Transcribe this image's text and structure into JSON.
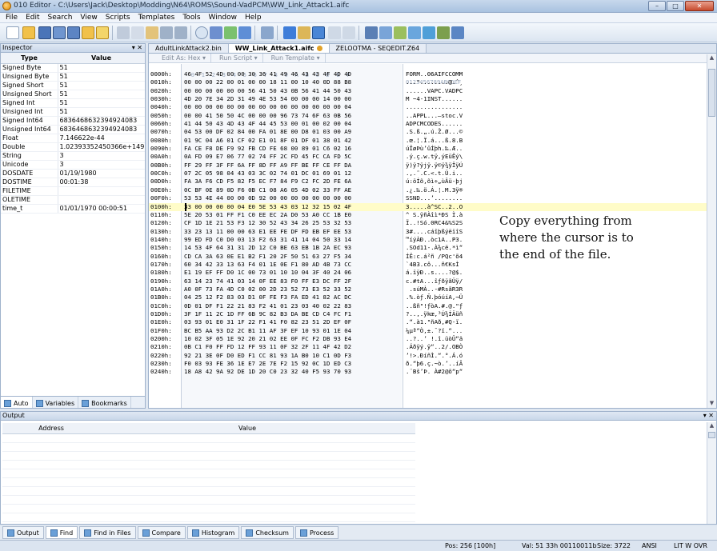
{
  "window": {
    "title": "010 Editor - C:\\Users\\Jack\\Desktop\\Modding\\N64\\ROMS\\Sound-VadPCM\\WW_Link_Attack1.aifc",
    "minimize": "–",
    "maximize": "□",
    "close": "✕"
  },
  "menu": [
    "File",
    "Edit",
    "Search",
    "View",
    "Scripts",
    "Templates",
    "Tools",
    "Window",
    "Help"
  ],
  "inspector": {
    "title": "Inspector",
    "controls": "▾ ✕",
    "col_type": "Type",
    "col_value": "Value",
    "rows": [
      {
        "type": "Signed Byte",
        "value": "51"
      },
      {
        "type": "Unsigned Byte",
        "value": "51"
      },
      {
        "type": "Signed Short",
        "value": "51"
      },
      {
        "type": "Unsigned Short",
        "value": "51"
      },
      {
        "type": "Signed Int",
        "value": "51"
      },
      {
        "type": "Unsigned Int",
        "value": "51"
      },
      {
        "type": "Signed Int64",
        "value": "6836468632394924083"
      },
      {
        "type": "Unsigned Int64",
        "value": "6836468632394924083"
      },
      {
        "type": "Float",
        "value": "7.146622e-44"
      },
      {
        "type": "Double",
        "value": "1.02393352450366e+149"
      },
      {
        "type": "String",
        "value": "3"
      },
      {
        "type": "Unicode",
        "value": "3"
      },
      {
        "type": "DOSDATE",
        "value": "01/19/1980"
      },
      {
        "type": "DOSTIME",
        "value": "00:01:38"
      },
      {
        "type": "FILETIME",
        "value": ""
      },
      {
        "type": "OLETIME",
        "value": ""
      },
      {
        "type": "time_t",
        "value": "01/01/1970 00:00:51"
      }
    ],
    "tabs": [
      "Auto",
      "Variables",
      "Bookmarks"
    ]
  },
  "editor": {
    "tabs": [
      {
        "label": "AdultLinkAttack2.bin",
        "active": false
      },
      {
        "label": "WW_Link_Attack1.aifc",
        "active": true
      },
      {
        "label": "ZELOOTMA - SEQEDIT.Z64",
        "active": false
      }
    ],
    "subbar": [
      "Edit As: Hex ▾",
      "Run Script ▾",
      "Run Template ▾"
    ],
    "header_hex": "  0  1  2  3  4  5  6  7  8  9  A  B  C  D  E  F",
    "header_ascii": "0123456789ABCDEF",
    "rows": [
      {
        "addr": "0000h:",
        "hex": "46 4F 52 4D 00 00 30 36 41 49 46 43 43 4F 4D 4D",
        "ascii": "FORM..06AIFCCOMM"
      },
      {
        "addr": "0010h:",
        "hex": "00 00 00 22 00 01 00 00 18 11 00 10 40 0D 88 B8",
        "ascii": "...\"........@.ˆ¸"
      },
      {
        "addr": "0020h:",
        "hex": "00 00 00 00 00 00 56 41 50 43 0B 56 41 44 50 43",
        "ascii": "......VAPC.VADPC"
      },
      {
        "addr": "0030h:",
        "hex": "4D 20 7E 34 2D 31 49 4E 53 54 00 00 00 14 00 00",
        "ascii": "M ~4-1INST......"
      },
      {
        "addr": "0040h:",
        "hex": "00 00 00 00 00 00 00 00 00 00 00 00 00 00 00 04",
        "ascii": "................"
      },
      {
        "addr": "0050h:",
        "hex": "00 00 41 50 50 4C 00 00 00 96 73 74 6F 63 0B 56",
        "ascii": "..APPL...–stoc.V"
      },
      {
        "addr": "0060h:",
        "hex": "41 44 50 43 4D 43 4F 44 45 53 00 01 00 02 00 04",
        "ascii": "ADPCMCODES......"
      },
      {
        "addr": "0070h:",
        "hex": "04 53 00 DF 02 84 00 FA 01 8E 00 D8 01 03 00 A9",
        "ascii": ".S.ß.„.ú.Ž.Ø...©"
      },
      {
        "addr": "0080h:",
        "hex": "01 9C 04 A6 01 CF 02 E1 01 8F 01 DF 01 38 01 42",
        "ascii": ".œ.¦.Ï.á...ß.8.B"
      },
      {
        "addr": "0090h:",
        "hex": "FA CE F8 DE F9 92 FB CD FE 68 00 89 01 C6 02 16",
        "ascii": "úÎøÞù’ûÍþh.‰.Æ.."
      },
      {
        "addr": "00A0h:",
        "hex": "0A FD 09 E7 06 77 02 74 FF 2C FD 45 FC CA FD 5C",
        "ascii": ".ý.ç.w.tÿ,ýEüÊý\\"
      },
      {
        "addr": "00B0h:",
        "hex": "FF 29 FF 3F FF 6A FF 8D FF A9 FF BE FF CE FF DA",
        "ascii": "ÿ)ÿ?ÿjÿ.ÿ©ÿ¾ÿÎÿÚ"
      },
      {
        "addr": "00C0h:",
        "hex": "07 2C 05 98 04 43 03 3C 02 74 01 DC 01 69 01 12",
        "ascii": ".,.˜.C.<.t.Ü.i.."
      },
      {
        "addr": "00D0h:",
        "hex": "FA 3A F6 CD F5 82 F5 EC F7 84 F9 C2 FC 2D FE 6A",
        "ascii": "ú:öÍõ‚õì÷„ùÂü-þj"
      },
      {
        "addr": "00E0h:",
        "hex": "0C BF 0E 89 0D F6 0B C1 08 A6 05 4D 02 33 FF AE",
        "ascii": ".¿.‰.ö.Á.¦.M.3ÿ®"
      },
      {
        "addr": "00F0h:",
        "hex": "53 53 4E 44 00 00 0D 92 00 00 00 00 00 00 00 00",
        "ascii": "SSND...’........"
      },
      {
        "addr": "0100h:",
        "hex": "33 00 00 00 00 04 E0 5E 53 43 03 12 32 15 02 4F",
        "ascii": "3.....à^SC..2..O",
        "hl": true
      },
      {
        "addr": "0110h:",
        "hex": "5E 20 53 01 FF F1 C0 EE EC 2A D0 53 A0 CC 1B E0",
        "ascii": "^ S.ÿñÀîì*ÐS Ì.à"
      },
      {
        "addr": "0120h:",
        "hex": "CF 1D 1E 21 53 F3 12 30 52 43 34 26 25 53 32 53",
        "ascii": "Ï..!Só.0RC4&%S2S"
      },
      {
        "addr": "0130h:",
        "hex": "33 23 13 11 00 00 63 E1 EE FE DF FD EB EF EE 53",
        "ascii": "3#....cáîþßýëïîS"
      },
      {
        "addr": "0140h:",
        "hex": "99 ED FD C0 D0 03 13 F2 63 31 41 14 04 50 33 14",
        "ascii": "™íýÀÐ..òc1A..P3."
      },
      {
        "addr": "0150h:",
        "hex": "14 53 4F 64 31 31 2D 12 C0 BE 63 EB 1B 2A EC 93",
        "ascii": ".SOd11-.À¾cë.*ì“"
      },
      {
        "addr": "0160h:",
        "hex": "CD CA 3A 63 0E E1 B2 F1 20 2F 50 51 63 27 F5 34",
        "ascii": "ÍÊ:c.á²ñ /PQc'õ4"
      },
      {
        "addr": "0170h:",
        "hex": "60 34 42 33 13 63 F4 01 1E 0E F1 80 AD 4B 73 CC",
        "ascii": "`4B3.cô...ñ€­KsÌ"
      },
      {
        "addr": "0180h:",
        "hex": "E1 19 EF FF D0 1C 00 73 01 10 10 04 3F 40 24 06",
        "ascii": "á.ïÿÐ..s....?@$."
      },
      {
        "addr": "0190h:",
        "hex": "63 14 23 74 41 03 14 0F EE 83 F0 FF E3 DC FF 2F",
        "ascii": "c.#tA...îƒðÿãÜÿ/"
      },
      {
        "addr": "01A0h:",
        "hex": "A0 0F 73 FA 4D C0 02 00 2D 23 52 73 E3 52 33 52",
        "ascii": " .súMÀ..-#RsãR3R"
      },
      {
        "addr": "01B0h:",
        "hex": "04 25 12 F2 83 03 D1 0F FE F3 FA ED 41 82 AC DC",
        "ascii": ".%.òƒ.Ñ.þóúíA‚¬Ü"
      },
      {
        "addr": "01C0h:",
        "hex": "0D 01 DF F1 22 21 83 F2 41 01 23 03 40 02 22 83",
        "ascii": "..ßñ\"!ƒòA.#.@.\"ƒ"
      },
      {
        "addr": "01D0h:",
        "hex": "3F 1F 11 2C 1D FF 6B 9C 82 B3 DA BE CD C4 FC F1",
        "ascii": "?..,.ÿkœ‚³Ú¾ÍÄüñ"
      },
      {
        "addr": "01E0h:",
        "hex": "03 93 01 E0 31 1F 22 F1 41 F0 82 23 51 2D EF 0F",
        "ascii": ".“.à1.\"ñAð‚#Q-ï."
      },
      {
        "addr": "01F0h:",
        "hex": "BC B5 AA 93 D2 2C B1 11 AF 3F EF 10 93 01 1E 04",
        "ascii": "¼µª“Ò,±.¯?ï.“..."
      },
      {
        "addr": "0200h:",
        "hex": "10 02 3F 05 1E 92 20 21 02 EE 0F FC F2 DB 93 E4",
        "ascii": "..?..’ !.î.üòÛ“ä"
      },
      {
        "addr": "0210h:",
        "hex": "0B C1 F0 FF FD 12 FF 93 11 0F 32 2F 11 4F 42 D2",
        "ascii": ".Áðÿý.ÿ“..2/.OBÒ"
      },
      {
        "addr": "0220h:",
        "hex": "92 21 3E 0F D0 ED F1 CC 81 93 1A B0 10 C1 0D F3",
        "ascii": "’!>.ÐíñÌ.“.°.Á.ó"
      },
      {
        "addr": "0230h:",
        "hex": "F0 03 93 FE 36 1E E7 2E 7E F2 15 92 0C 1D ED C3",
        "ascii": "ð.“þ6.ç.~ò.’..íÃ"
      },
      {
        "addr": "0240h:",
        "hex": "18 A8 42 9A 92 DE 1D 20 C0 23 32 40 F5 93 70 93",
        "ascii": ".¨Bš’Þ. À#2@õ“p“"
      }
    ],
    "note": "Copy everything from where the cursor is to the end of the file."
  },
  "output": {
    "title": "Output",
    "controls": "▾ ✕",
    "col_address": "Address",
    "col_value": "Value",
    "tabs": [
      "Output",
      "Find",
      "Find in Files",
      "Compare",
      "Histogram",
      "Checksum",
      "Process"
    ],
    "active_tab": "Find"
  },
  "status": {
    "pos": "Pos: 256 [100h]",
    "val": "Val: 51 33h 00110011b",
    "size": "Size: 3722",
    "encoding": "ANSI",
    "flags": "LIT  W  OVR"
  }
}
